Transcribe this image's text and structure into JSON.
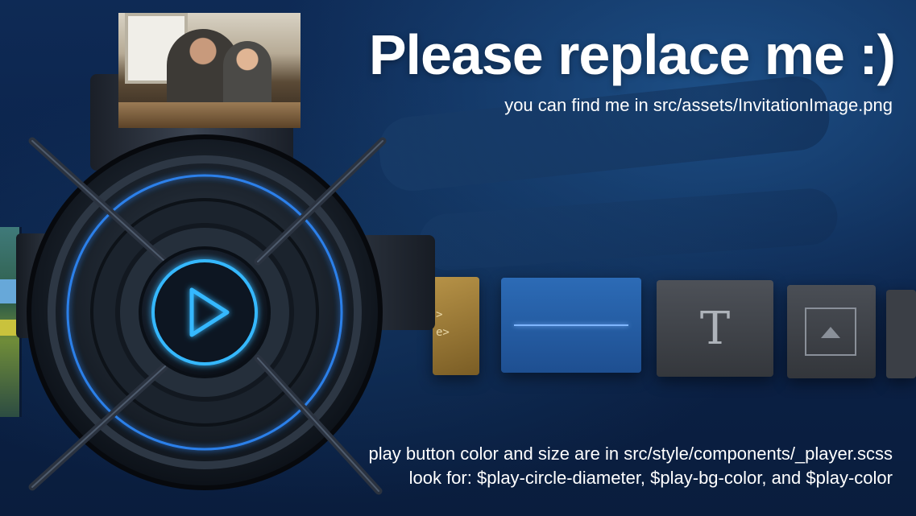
{
  "banner": {
    "title": "Please replace me :)",
    "subtitle": "you can find me in src/assets/InvitationImage.png",
    "note_line1": "play button color and size are in src/style/components/_player.scss",
    "note_line2": "look for: $play-circle-diameter, $play-bg-color, and $play-color"
  },
  "timeline": {
    "code_glyph_1": ">",
    "code_glyph_2": "e>",
    "text_glyph": "T"
  },
  "icons": {
    "play": "play-icon",
    "text": "text-icon",
    "image": "image-icon",
    "code": "code-icon",
    "waveform": "waveform-icon"
  },
  "colors": {
    "background": "#0b1f3f",
    "ring_glow": "#2f8bff",
    "play_glow": "#34b8ff",
    "title_text": "#ffffff"
  }
}
